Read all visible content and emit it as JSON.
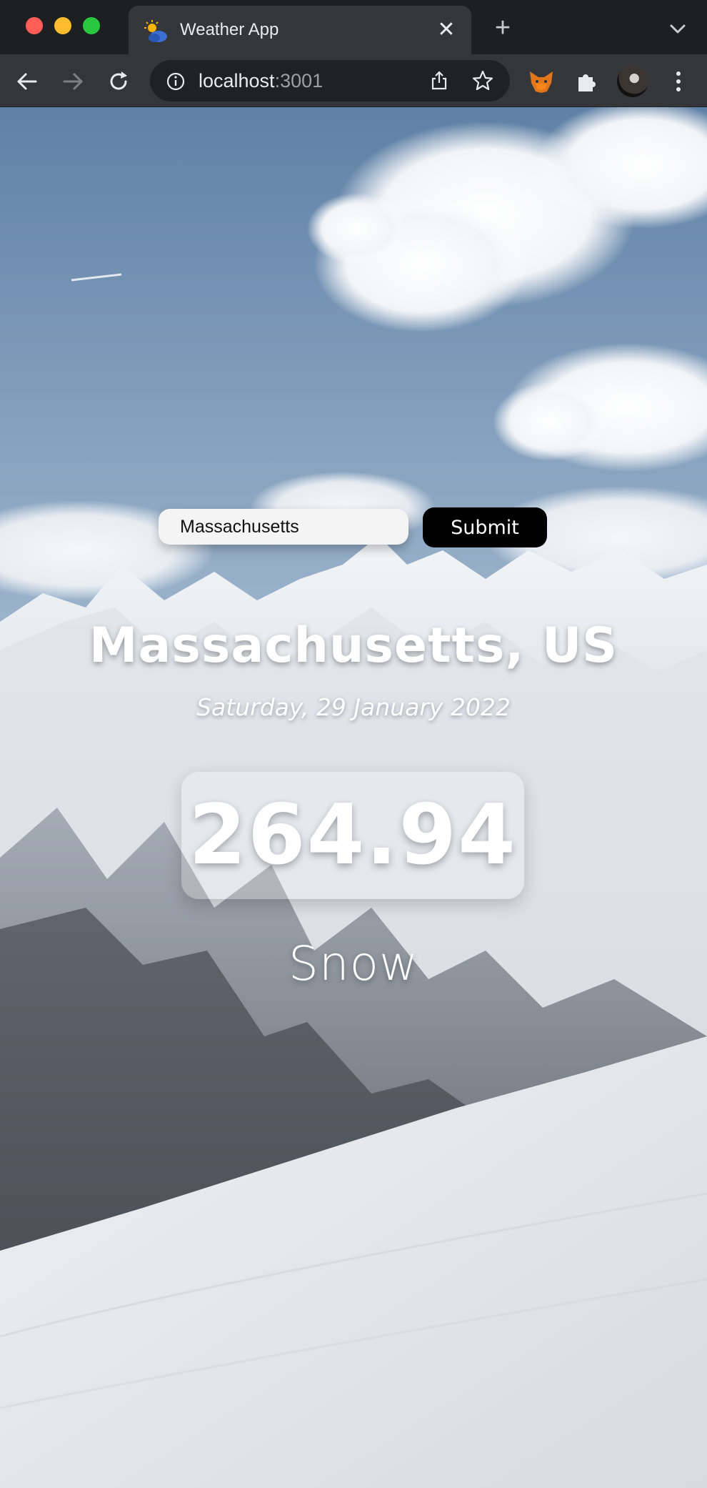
{
  "browser": {
    "tab_title": "Weather App",
    "new_tab_symbol": "+",
    "close_symbol": "✕",
    "url_host": "localhost",
    "url_port": ":3001"
  },
  "search": {
    "input_value": "Massachusetts",
    "submit_label": "Submit"
  },
  "weather": {
    "location": "Massachusetts, US",
    "date": "Saturday, 29 January 2022",
    "temperature": "264.94",
    "condition": "Snow"
  },
  "colors": {
    "chrome_dark": "#1e1f21",
    "toolbar": "#35363a",
    "button_bg": "#000000",
    "text": "#ffffff"
  },
  "icons": {
    "toolbar": [
      "back-icon",
      "forward-icon",
      "reload-icon",
      "info-icon",
      "share-icon",
      "bookmark-star-icon",
      "metamask-fox-icon",
      "extensions-puzzle-icon",
      "profile-avatar",
      "menu-kebab-icon"
    ]
  }
}
